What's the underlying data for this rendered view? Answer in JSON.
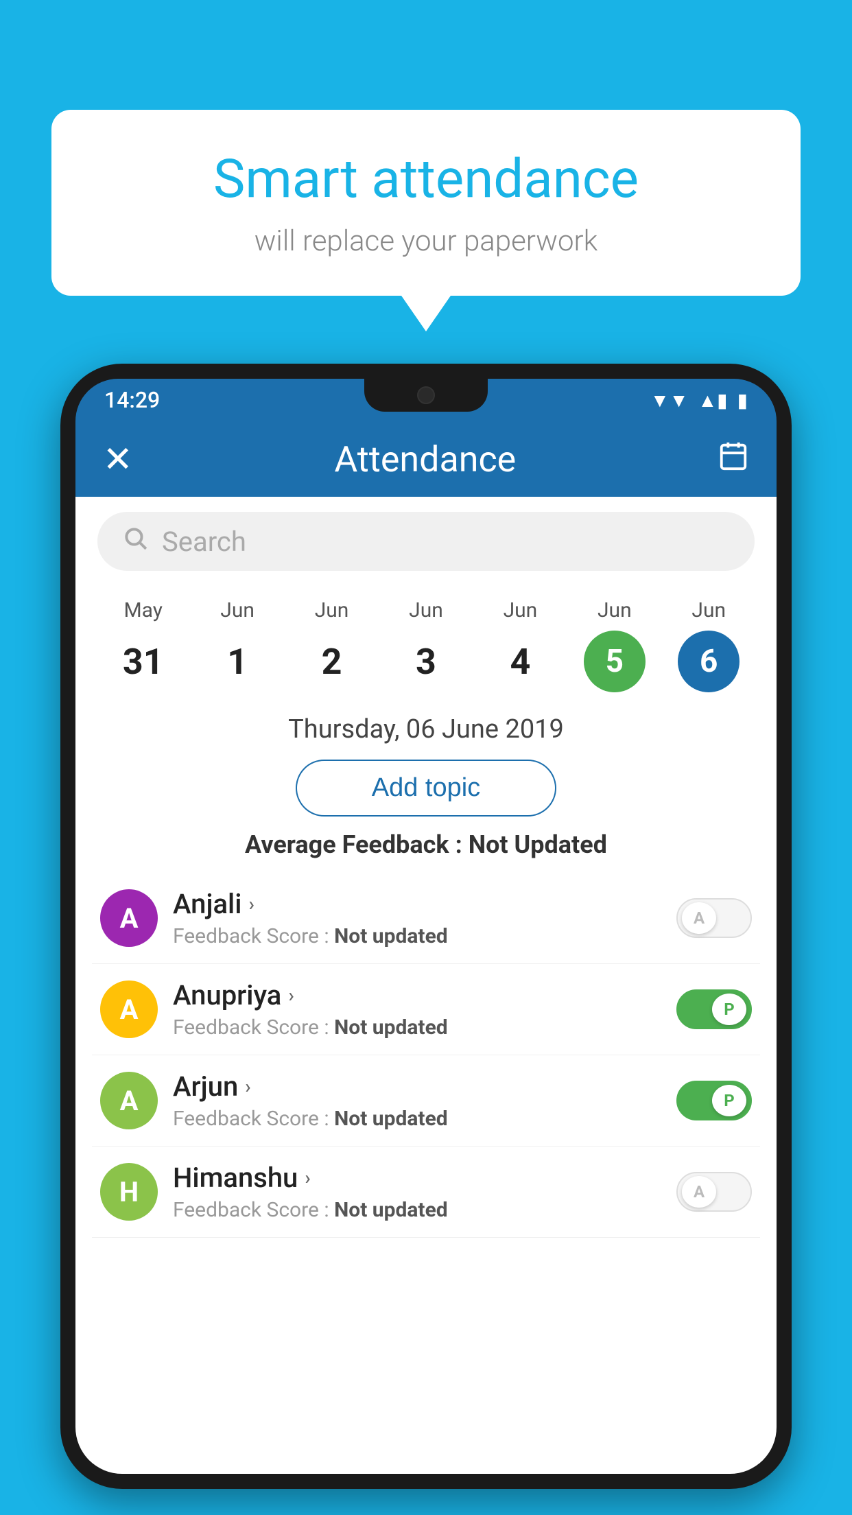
{
  "background": {
    "color": "#19B3E6"
  },
  "bubble": {
    "title": "Smart attendance",
    "subtitle": "will replace your paperwork"
  },
  "statusBar": {
    "time": "14:29",
    "wifiIcon": "▼",
    "signalIcon": "▲",
    "batteryIcon": "▮"
  },
  "header": {
    "title": "Attendance",
    "closeLabel": "✕",
    "calendarIcon": "📅"
  },
  "search": {
    "placeholder": "Search"
  },
  "calendar": {
    "days": [
      {
        "month": "May",
        "date": "31",
        "style": "normal"
      },
      {
        "month": "Jun",
        "date": "1",
        "style": "normal"
      },
      {
        "month": "Jun",
        "date": "2",
        "style": "normal"
      },
      {
        "month": "Jun",
        "date": "3",
        "style": "normal"
      },
      {
        "month": "Jun",
        "date": "4",
        "style": "normal"
      },
      {
        "month": "Jun",
        "date": "5",
        "style": "today"
      },
      {
        "month": "Jun",
        "date": "6",
        "style": "selected"
      }
    ],
    "selectedDate": "Thursday, 06 June 2019"
  },
  "addTopic": {
    "label": "Add topic"
  },
  "avgFeedback": {
    "label": "Average Feedback : ",
    "value": "Not Updated"
  },
  "students": [
    {
      "name": "Anjali",
      "avatarLetter": "A",
      "avatarColor": "#9C27B0",
      "feedbackLabel": "Feedback Score : ",
      "feedbackValue": "Not updated",
      "attendance": "absent",
      "toggleLabel": "A"
    },
    {
      "name": "Anupriya",
      "avatarLetter": "A",
      "avatarColor": "#FFC107",
      "feedbackLabel": "Feedback Score : ",
      "feedbackValue": "Not updated",
      "attendance": "present",
      "toggleLabel": "P"
    },
    {
      "name": "Arjun",
      "avatarLetter": "A",
      "avatarColor": "#8BC34A",
      "feedbackLabel": "Feedback Score : ",
      "feedbackValue": "Not updated",
      "attendance": "present",
      "toggleLabel": "P"
    },
    {
      "name": "Himanshu",
      "avatarLetter": "H",
      "avatarColor": "#8BC34A",
      "feedbackLabel": "Feedback Score : ",
      "feedbackValue": "Not updated",
      "attendance": "absent",
      "toggleLabel": "A"
    }
  ]
}
